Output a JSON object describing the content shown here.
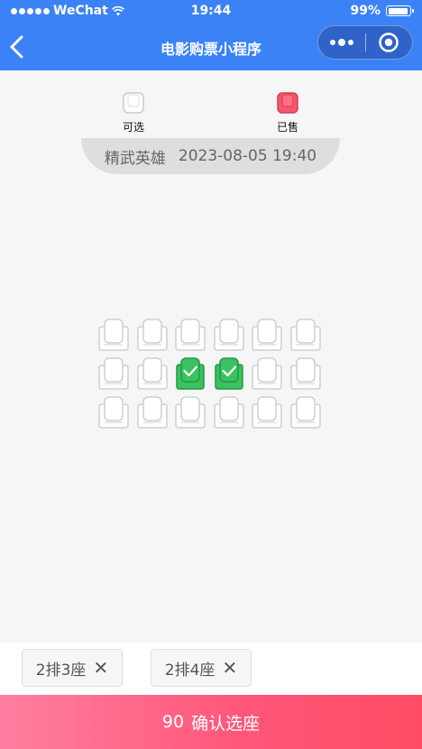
{
  "status_bar": {
    "carrier": "WeChat",
    "time": "19:44",
    "battery": "99%",
    "battery_level": 0.99
  },
  "nav": {
    "title": "电影购票小程序",
    "back_icon": "chevron-left-icon",
    "more_icon": "more-dots-icon",
    "close_icon": "target-circle-icon"
  },
  "legend": {
    "available_label": "可选",
    "sold_label": "已售"
  },
  "movie": {
    "title": "精武英雄",
    "showtime": "2023-08-05 19:40"
  },
  "seats": {
    "rows": 3,
    "cols": 6,
    "states": [
      [
        "available",
        "available",
        "available",
        "available",
        "available",
        "available"
      ],
      [
        "available",
        "available",
        "selected",
        "selected",
        "available",
        "available"
      ],
      [
        "available",
        "available",
        "available",
        "available",
        "available",
        "available"
      ]
    ]
  },
  "selected_seats": [
    {
      "label": "2排3座",
      "remove_symbol": "✕"
    },
    {
      "label": "2排4座",
      "remove_symbol": "✕"
    }
  ],
  "confirm": {
    "price": "90",
    "label": "确认选座"
  },
  "colors": {
    "nav_blue": "#3b82f6",
    "seat_selected": "#3cc162",
    "seat_sold": "#f5576c",
    "confirm_gradient_start": "#ff7fa0",
    "confirm_gradient_end": "#ff4d64"
  }
}
